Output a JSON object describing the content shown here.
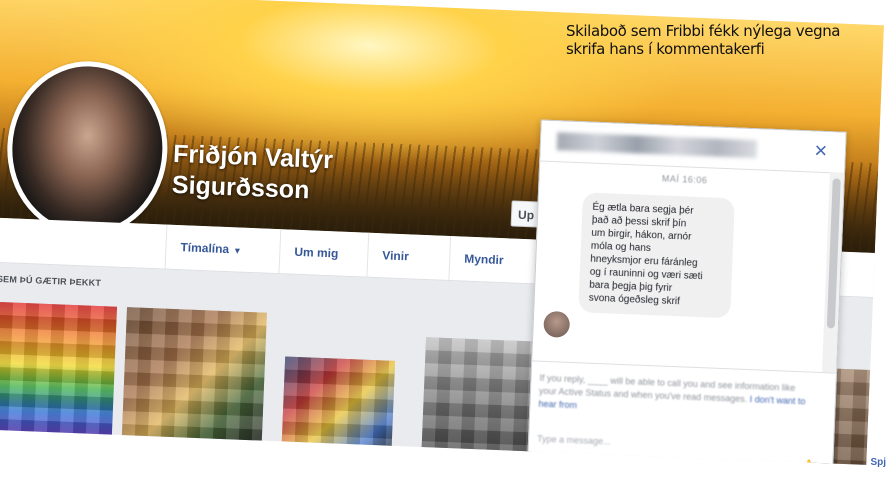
{
  "profile": {
    "name_line1": "Friðjón Valtýr",
    "name_line2": "Sigurðsson",
    "update_button": "Up"
  },
  "tabs": [
    {
      "label": "Tímalína",
      "caret": "▾"
    },
    {
      "label": "Um mig"
    },
    {
      "label": "Vinir"
    },
    {
      "label": "Myndir"
    }
  ],
  "section_label": "E SEM ÞÚ GÆTIR ÞEKKT",
  "caption": {
    "line1": "Skilaboð sem Fribbi fékk nýlega vegna",
    "line2": "skrifa hans í kommentakerfi"
  },
  "chat": {
    "close_icon": "×",
    "date": "MAÍ 16:06",
    "message_lines": [
      "Ég ætla bara segja þér",
      "það að þessi skrif þín",
      "um birgir, hákon, arnór",
      "móla og hans",
      "hneyksmjor eru fáránleg",
      "og í rauninni og væri sæti",
      "bara þegja þig fyrir",
      "svona ógeðsleg skrif"
    ],
    "notice_text": "If you reply, ____ will be able to call you and see information like your Active Status and when you've read messages.",
    "notice_link": "I don't want to hear from",
    "type_placeholder": "Type a message...",
    "like_icon": "👍"
  },
  "corner_text": "Spj"
}
